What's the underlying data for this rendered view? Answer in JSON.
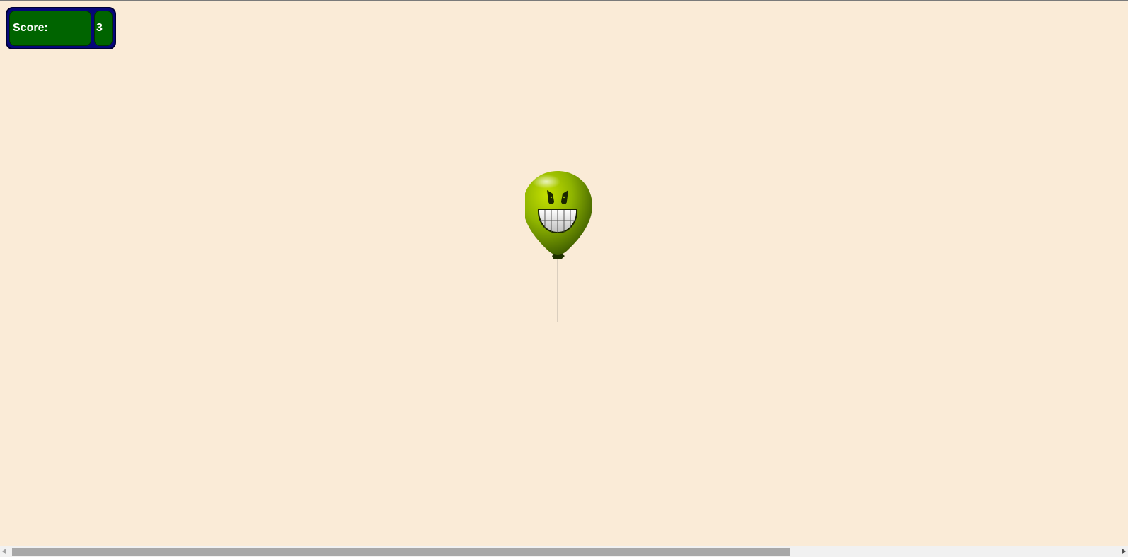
{
  "score": {
    "label": "Score:",
    "value": "3"
  },
  "balloon": {
    "icon": "grinning-devil-balloon-icon",
    "color": "#8fb400"
  },
  "colors": {
    "background": "#FAEBD7",
    "panel_border": "#06067a",
    "panel_fill": "#006400",
    "text": "#ffffff"
  },
  "scrollbar": {
    "thumb_fraction": 0.7
  }
}
